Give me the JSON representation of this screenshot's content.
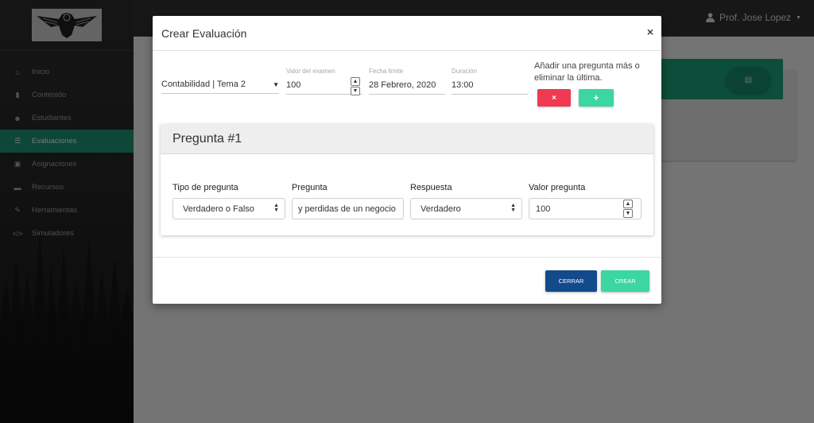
{
  "topbar": {
    "user_name": "Prof. Jose Lopez"
  },
  "sidebar": {
    "items": [
      {
        "label": "Inicio",
        "icon": "home-icon",
        "glyph": "⌂"
      },
      {
        "label": "Contenido",
        "icon": "book-icon",
        "glyph": "▮"
      },
      {
        "label": "Estudiantes",
        "icon": "users-icon",
        "glyph": "☻"
      },
      {
        "label": "Evaluaciones",
        "icon": "list-icon",
        "glyph": "☰"
      },
      {
        "label": "Asignaciones",
        "icon": "clipboard-icon",
        "glyph": "▣"
      },
      {
        "label": "Recursos",
        "icon": "archive-icon",
        "glyph": "▬"
      },
      {
        "label": "Herramientas",
        "icon": "wrench-icon",
        "glyph": "✎"
      },
      {
        "label": "Simuladores",
        "icon": "code-icon",
        "glyph": "</>"
      }
    ],
    "active_index": 3
  },
  "modal": {
    "title": "Crear Evaluación",
    "close_glyph": "×",
    "subject_value": "Contabilidad | Tema 2",
    "exam_value_label": "Valor del examen",
    "exam_value": "100",
    "deadline_label": "Fecha limite",
    "deadline_value": "28 Febrero, 2020",
    "duration_label": "Duración",
    "duration_value": "13:00",
    "hint_text": "Añadir una pregunta más o eliminar la última.",
    "remove_glyph": "×",
    "add_glyph": "+",
    "question": {
      "title": "Pregunta #1",
      "type_label": "Tipo de pregunta",
      "type_value": "Verdadero o Falso",
      "question_label": "Pregunta",
      "question_value": "y perdidas de un negocio",
      "answer_label": "Respuesta",
      "answer_value": "Verdadero",
      "points_label": "Valor pregunta",
      "points_value": "100"
    },
    "close_button": "CERRAR",
    "create_button": "CREAR"
  },
  "colors": {
    "accent_green": "#1a9c74",
    "add_button": "#3cd6a2",
    "remove_button": "#ef3a52",
    "close_button": "#124a8c"
  }
}
